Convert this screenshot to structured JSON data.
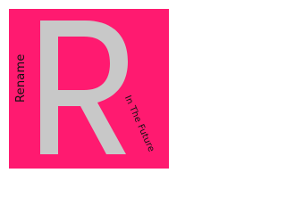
{
  "logo": {
    "letter": "R",
    "side_text": "Rename",
    "slant_text": "In The Future"
  },
  "colors": {
    "page_background": "#ffffff",
    "panel_background": "#ff1a70",
    "letter_fill": "#c8c8c8",
    "text": "#111111"
  }
}
